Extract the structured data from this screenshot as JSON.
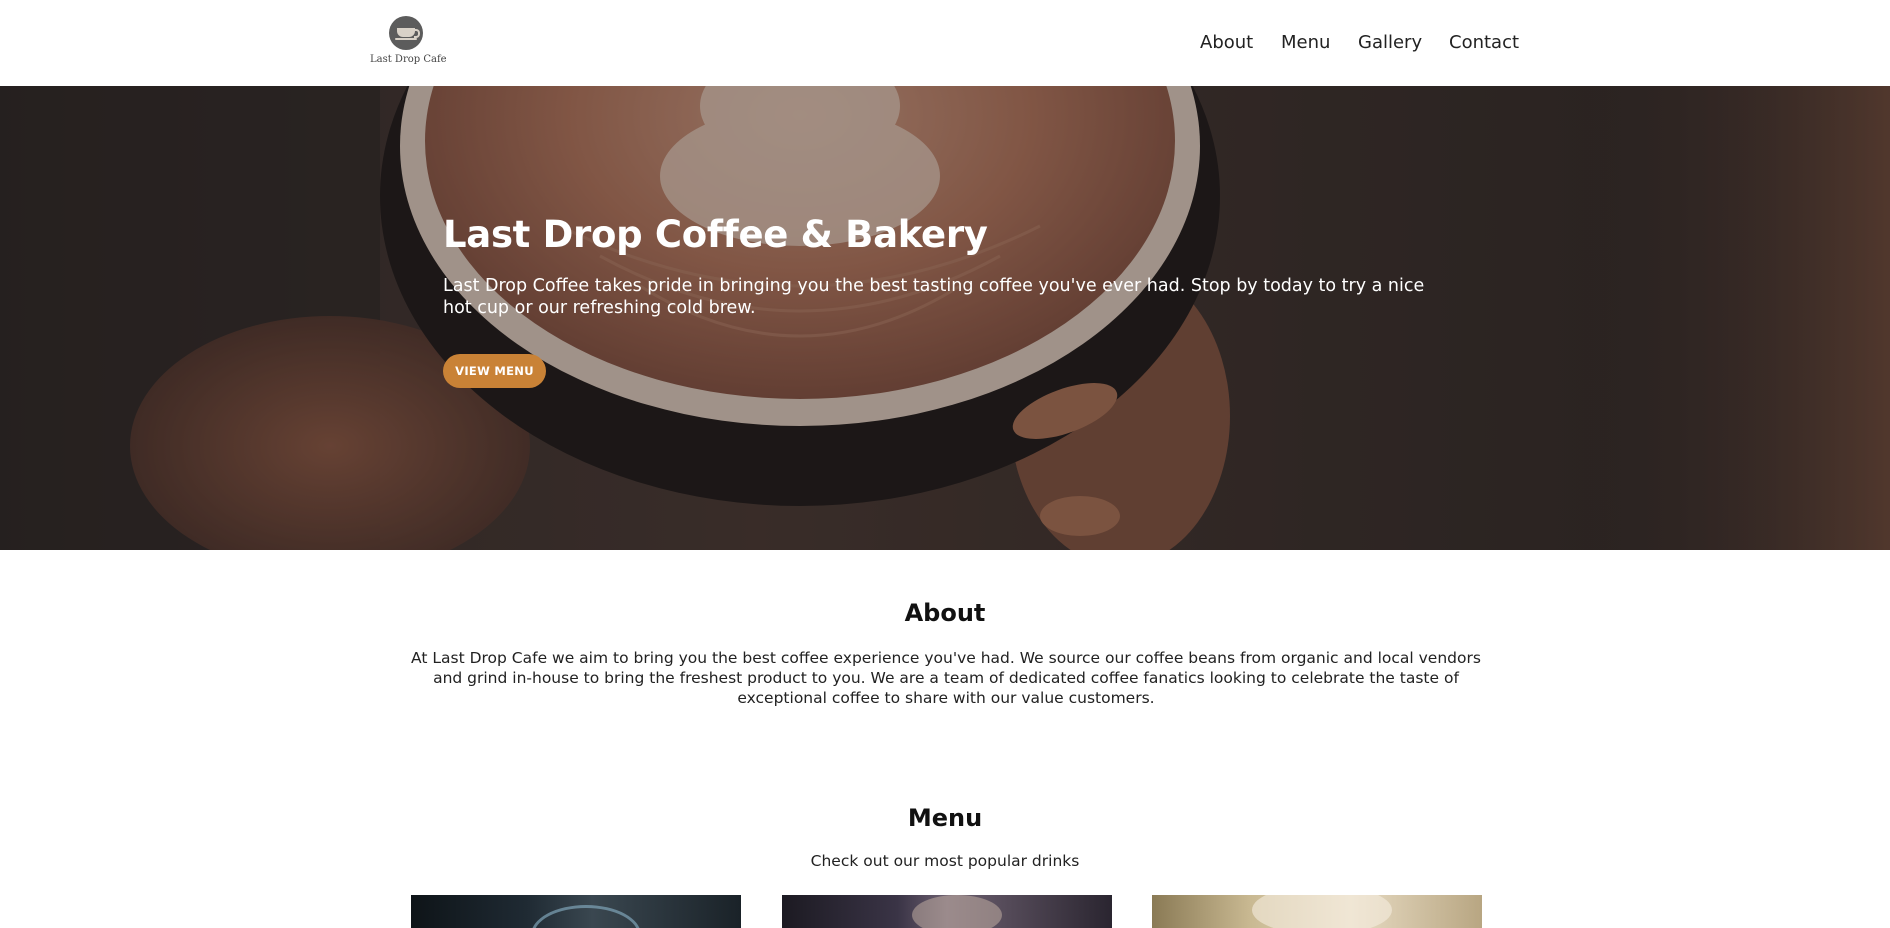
{
  "header": {
    "logo_text": "Last Drop Cafe",
    "logo_icon": "coffee-cup-icon",
    "nav": [
      "About",
      "Menu",
      "Gallery",
      "Contact"
    ]
  },
  "hero": {
    "title": "Last Drop Coffee & Bakery",
    "text": "Last Drop Coffee takes pride in bringing you the best tasting coffee you've ever had. Stop by today to try a nice hot cup or our refreshing cold brew.",
    "button": "VIEW MENU"
  },
  "about": {
    "title": "About",
    "text": "At Last Drop Cafe we aim to bring you the best coffee experience you've had. We source our coffee beans from organic and local vendors and grind in-house to bring the freshest product to you. We are a team of dedicated coffee fanatics looking to celebrate the taste of exceptional coffee to share with our value customers."
  },
  "menu": {
    "title": "Menu",
    "subtitle": "Check out our most popular drinks"
  },
  "colors": {
    "accent": "#c98236",
    "text": "#222222",
    "hero_overlay": "#3a302c"
  }
}
